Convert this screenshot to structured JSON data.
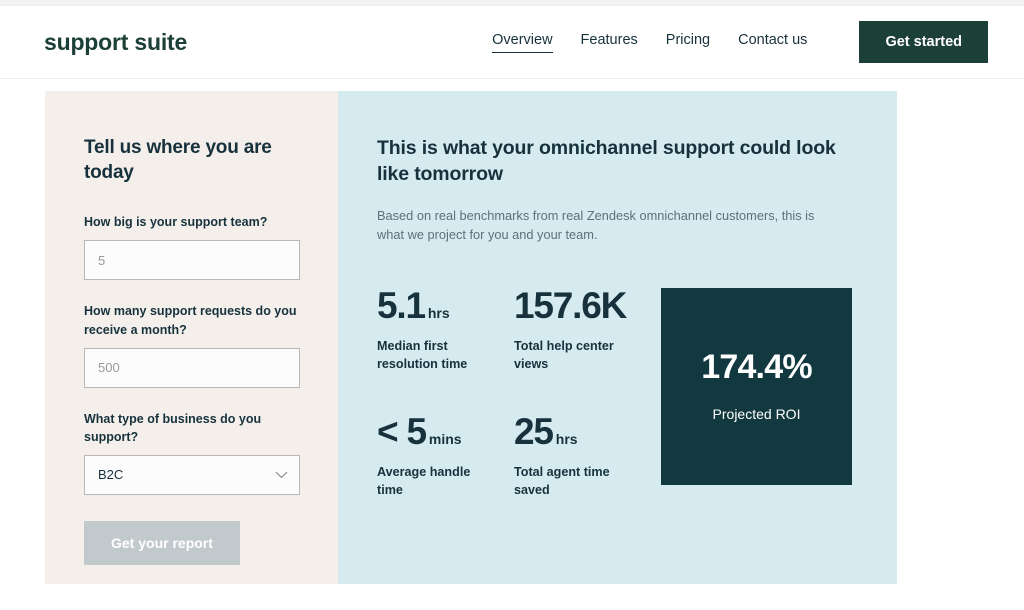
{
  "header": {
    "logo": "support suite",
    "nav": [
      {
        "label": "Overview",
        "active": true
      },
      {
        "label": "Features",
        "active": false
      },
      {
        "label": "Pricing",
        "active": false
      },
      {
        "label": "Contact us",
        "active": false
      }
    ],
    "cta_label": "Get started"
  },
  "form": {
    "title": "Tell us where you are today",
    "fields": [
      {
        "label": "How big is your support team?",
        "placeholder": "5",
        "value": ""
      },
      {
        "label": "How many support requests do you receive a month?",
        "placeholder": "500",
        "value": ""
      },
      {
        "label": "What type of business do you support?",
        "value": "B2C"
      }
    ],
    "submit_label": "Get your report"
  },
  "results": {
    "title": "This is what your omnichannel support could look like tomorrow",
    "subtitle": "Based on real benchmarks from real Zendesk omnichannel customers, this is what we project for you and your team.",
    "stats": [
      {
        "value": "5.1",
        "unit": "hrs",
        "label": "Median first resolution time"
      },
      {
        "value": "157.6K",
        "unit": "",
        "label": "Total help center views"
      },
      {
        "value": "< 5",
        "unit": "mins",
        "label": "Average handle time"
      },
      {
        "value": "25",
        "unit": "hrs",
        "label": "Total agent time saved"
      }
    ],
    "roi": {
      "value": "174.4%",
      "label": "Projected ROI"
    }
  },
  "colors": {
    "brand_dark": "#1c4038",
    "panel_left_bg": "#f4efeb",
    "panel_right_bg": "#d5ebf0",
    "roi_card_bg": "#11393f",
    "text_dark": "#17323d",
    "disabled_button": "#c2c9cd"
  }
}
